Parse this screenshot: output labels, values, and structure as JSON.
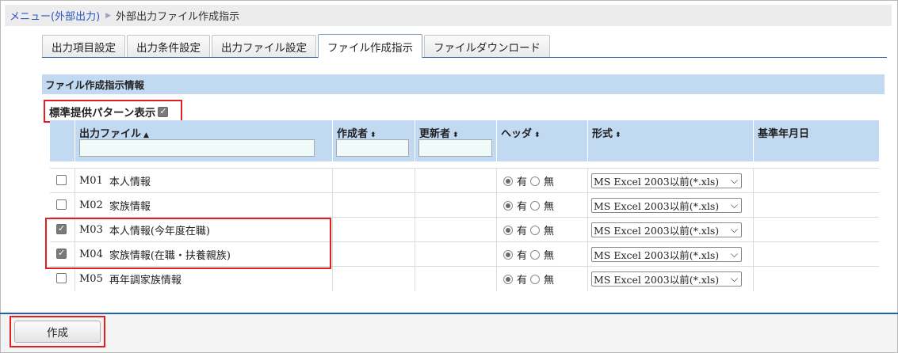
{
  "breadcrumb": {
    "parent": "メニュー(外部出力)",
    "current": "外部出力ファイル作成指示"
  },
  "tabs": [
    {
      "label": "出力項目設定",
      "active": false
    },
    {
      "label": "出力条件設定",
      "active": false
    },
    {
      "label": "出力ファイル設定",
      "active": false
    },
    {
      "label": "ファイル作成指示",
      "active": true
    },
    {
      "label": "ファイルダウンロード",
      "active": false
    }
  ],
  "section_title": "ファイル作成指示情報",
  "pattern": {
    "label": "標準提供パターン表示",
    "checked": true
  },
  "columns": {
    "file": "出力ファイル",
    "author": "作成者",
    "updater": "更新者",
    "header": "ヘッダ",
    "format": "形式",
    "base_date": "基準年月日"
  },
  "sort_icons": {
    "asc": "▲",
    "both": "⬍"
  },
  "radio_labels": {
    "yes": "有",
    "no": "無"
  },
  "rows": [
    {
      "code": "M01",
      "name": "本人情報",
      "checked": false,
      "header": "yes",
      "format": "MS Excel 2003以前(*.xls)"
    },
    {
      "code": "M02",
      "name": "家族情報",
      "checked": false,
      "header": "yes",
      "format": "MS Excel 2003以前(*.xls)"
    },
    {
      "code": "M03",
      "name": "本人情報(今年度在職)",
      "checked": true,
      "header": "yes",
      "format": "MS Excel 2003以前(*.xls)"
    },
    {
      "code": "M04",
      "name": "家族情報(在職・扶養親族)",
      "checked": true,
      "header": "yes",
      "format": "MS Excel 2003以前(*.xls)"
    },
    {
      "code": "M05",
      "name": "再年調家族情報",
      "checked": false,
      "header": "yes",
      "format": "MS Excel 2003以前(*.xls)"
    }
  ],
  "create_button": "作成",
  "colors": {
    "accent": "#1e63a8",
    "header_bg": "#c2d9f2",
    "highlight": "#e02020",
    "link": "#2b56c6"
  }
}
